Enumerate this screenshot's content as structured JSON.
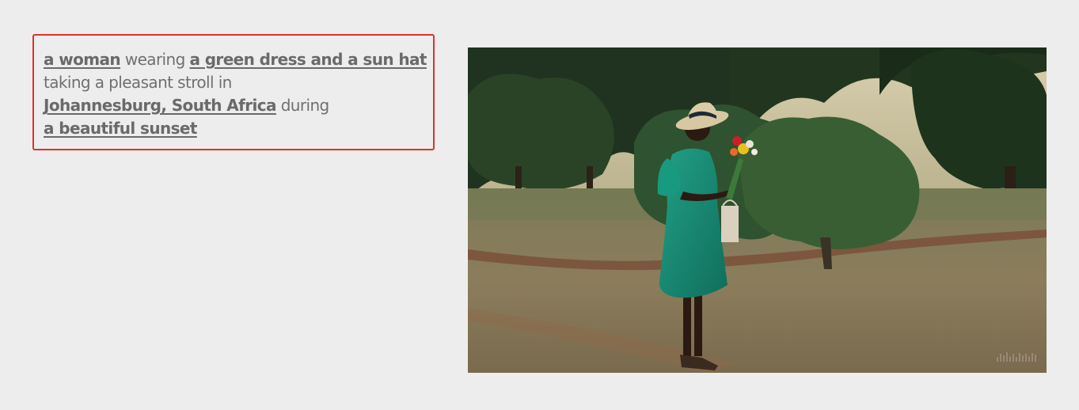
{
  "prompt": {
    "lines": [
      [
        {
          "text": "a woman",
          "token": true
        },
        {
          "text": " wearing ",
          "token": false
        },
        {
          "text": "a green dress and a sun hat",
          "token": true
        }
      ],
      [
        {
          "text": "taking a pleasant stroll in",
          "token": false
        }
      ],
      [
        {
          "text": "Johannesburg, South Africa",
          "token": true
        },
        {
          "text": " during",
          "token": false
        }
      ],
      [
        {
          "text": "a beautiful sunset",
          "token": true
        }
      ]
    ],
    "highlight_color": "#e0302b"
  },
  "video": {
    "scene": "woman in green dress and sun hat holding flowers in a park at sunset",
    "colors": {
      "sky": "#cfc7a8",
      "foliage_dark": "#243a22",
      "foliage_mid": "#3b5a33",
      "ground": "#8a7a5a",
      "path": "#7a4a34",
      "dress": "#1c8a74"
    }
  }
}
